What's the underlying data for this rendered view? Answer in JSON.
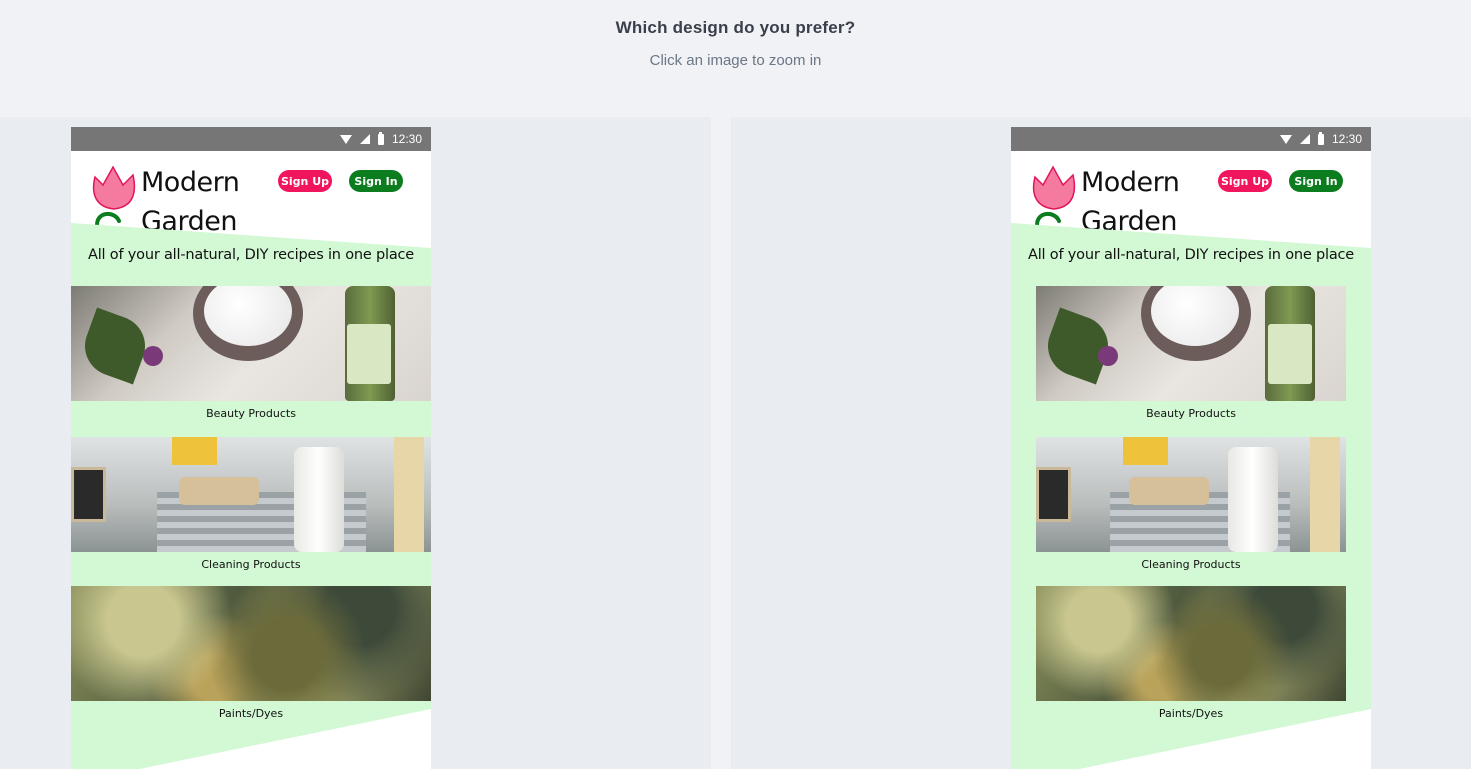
{
  "prompt": {
    "question": "Which design do you prefer?",
    "hint": "Click an image to zoom in"
  },
  "options": [
    {
      "status_time": "12:30",
      "brand_line1": "Modern",
      "brand_line2": "Garden",
      "signup_label": "Sign Up",
      "signin_label": "Sign In",
      "tagline": "All of your all-natural, DIY recipes in one place",
      "categories": [
        "Beauty Products",
        "Cleaning Products",
        "Paints/Dyes"
      ]
    },
    {
      "status_time": "12:30",
      "brand_line1": "Modern",
      "brand_line2": "Garden",
      "signup_label": "Sign Up",
      "signin_label": "Sign In",
      "tagline": "All of your all-natural, DIY recipes in one place",
      "categories": [
        "Beauty Products",
        "Cleaning Products",
        "Paints/Dyes"
      ]
    }
  ],
  "colors": {
    "signup": "#f0155c",
    "signin": "#0b7d1f",
    "band": "#d2f8d4",
    "statusbar": "#767676"
  },
  "icons": [
    "wifi-icon",
    "signal-icon",
    "battery-icon",
    "tulip-logo-icon"
  ]
}
